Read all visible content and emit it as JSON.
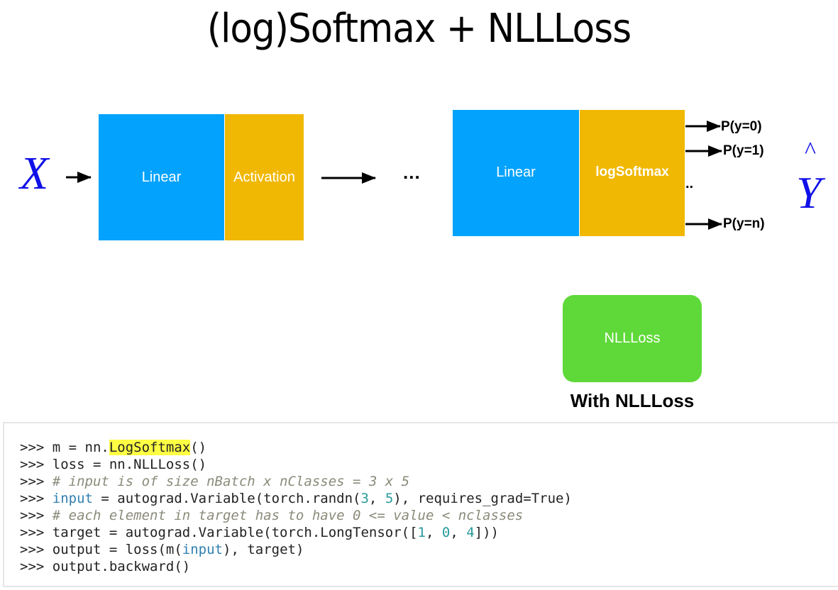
{
  "title": "(log)Softmax + NLLLoss",
  "diagram": {
    "input_var": "X",
    "output_var": "Y",
    "output_hat": "^",
    "first_layer": {
      "linear": "Linear",
      "activation": "Activation"
    },
    "middle_ellipsis": "...",
    "last_layer": {
      "linear": "Linear",
      "activation": "logSoftmax"
    },
    "outputs": [
      "P(y=0)",
      "P(y=1)",
      "P(y=n)"
    ],
    "outputs_ellipsis": "..",
    "loss_box": "NLLLoss",
    "loss_caption": "With NLLLoss",
    "colors": {
      "linear": "#03a2fd",
      "activation": "#f1b803",
      "loss": "#5fd939",
      "variable": "#1010e8"
    }
  },
  "code": {
    "prompt": ">>>",
    "lines": [
      {
        "parts": [
          {
            "t": "m = nn.",
            "c": ""
          },
          {
            "t": "LogSoftmax",
            "c": "hl"
          },
          {
            "t": "()",
            "c": ""
          }
        ]
      },
      {
        "parts": [
          {
            "t": "loss = nn.NLLLoss()",
            "c": ""
          }
        ]
      },
      {
        "parts": [
          {
            "t": "# input is of size nBatch x nClasses = 3 x 5",
            "c": "cm"
          }
        ]
      },
      {
        "parts": [
          {
            "t": "input",
            "c": "kw"
          },
          {
            "t": " = autograd.Variable(torch.randn(",
            "c": ""
          },
          {
            "t": "3",
            "c": "num"
          },
          {
            "t": ", ",
            "c": ""
          },
          {
            "t": "5",
            "c": "num"
          },
          {
            "t": "), requires_grad=True)",
            "c": ""
          }
        ]
      },
      {
        "parts": [
          {
            "t": "# each element in target has to have 0 <= value < nclasses",
            "c": "cm"
          }
        ]
      },
      {
        "parts": [
          {
            "t": "target = autograd.Variable(torch.LongTensor([",
            "c": ""
          },
          {
            "t": "1",
            "c": "num"
          },
          {
            "t": ", ",
            "c": ""
          },
          {
            "t": "0",
            "c": "num"
          },
          {
            "t": ", ",
            "c": ""
          },
          {
            "t": "4",
            "c": "num"
          },
          {
            "t": "]))",
            "c": ""
          }
        ]
      },
      {
        "parts": [
          {
            "t": "output = loss(m(",
            "c": ""
          },
          {
            "t": "input",
            "c": "kw"
          },
          {
            "t": "), target)",
            "c": ""
          }
        ]
      },
      {
        "parts": [
          {
            "t": "output.backward()",
            "c": ""
          }
        ]
      }
    ]
  }
}
